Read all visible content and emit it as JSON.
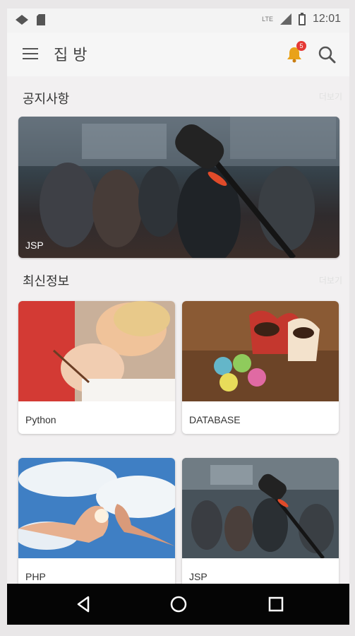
{
  "status_bar": {
    "time": "12:01",
    "network_label": "LTE"
  },
  "app_bar": {
    "title": "집 방",
    "notification_count": "5"
  },
  "sections": {
    "notices": {
      "title": "공지사항",
      "more": "더보기",
      "banner": {
        "label": "JSP"
      }
    },
    "latest": {
      "title": "최신정보",
      "more": "더보기",
      "cards": [
        {
          "label": "Python"
        },
        {
          "label": "DATABASE"
        },
        {
          "label": "PHP"
        },
        {
          "label": "JSP"
        }
      ]
    }
  },
  "colors": {
    "badge": "#e53935",
    "nav_bar": "#050505"
  }
}
